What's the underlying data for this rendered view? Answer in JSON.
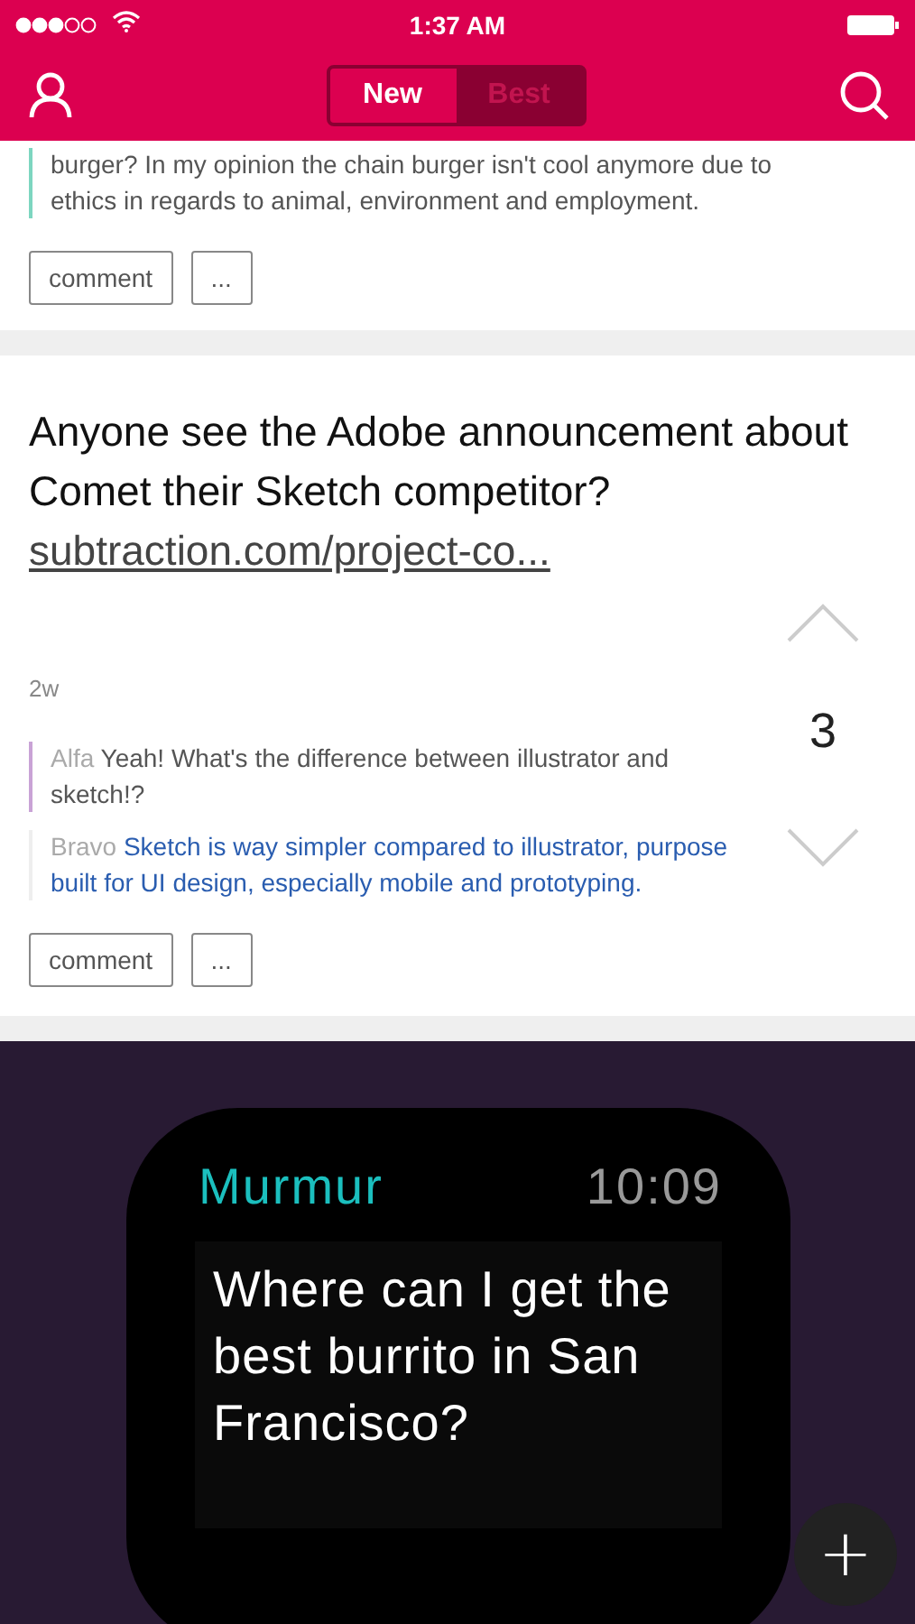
{
  "status_bar": {
    "time": "1:37 AM"
  },
  "nav": {
    "segments": [
      {
        "label": "New",
        "selected": true
      },
      {
        "label": "Best",
        "selected": false
      }
    ]
  },
  "posts": [
    {
      "kind": "partial",
      "comments": [
        {
          "text": "burger? In my opinion the chain burger isn't cool anymore due to ethics in regards to animal, environment and employment.",
          "color": "#7dd6c0",
          "highlighted": false
        }
      ],
      "actions": [
        "comment",
        "..."
      ]
    },
    {
      "kind": "full",
      "title": "Anyone see the Adobe announcement about Comet their Sketch competitor?",
      "link": "subtraction.com/project-co...",
      "age": "2w",
      "votes": "3",
      "comments": [
        {
          "author": "Alfa",
          "text": "Yeah! What's the difference between illustrator and sketch!?",
          "color": "#c9a3d6",
          "highlighted": false
        },
        {
          "author": "Bravo",
          "text": "Sketch is way simpler compared to illustrator, purpose built for UI design, especially mobile and prototyping.",
          "color": "#eeeeee",
          "highlighted": true
        }
      ],
      "actions": [
        "comment",
        "..."
      ]
    }
  ],
  "promo": {
    "app_name": "Murmur",
    "time": "10:09",
    "message": "Where can I get the best burrito in San Francisco?"
  },
  "fab": {
    "label": "+"
  }
}
